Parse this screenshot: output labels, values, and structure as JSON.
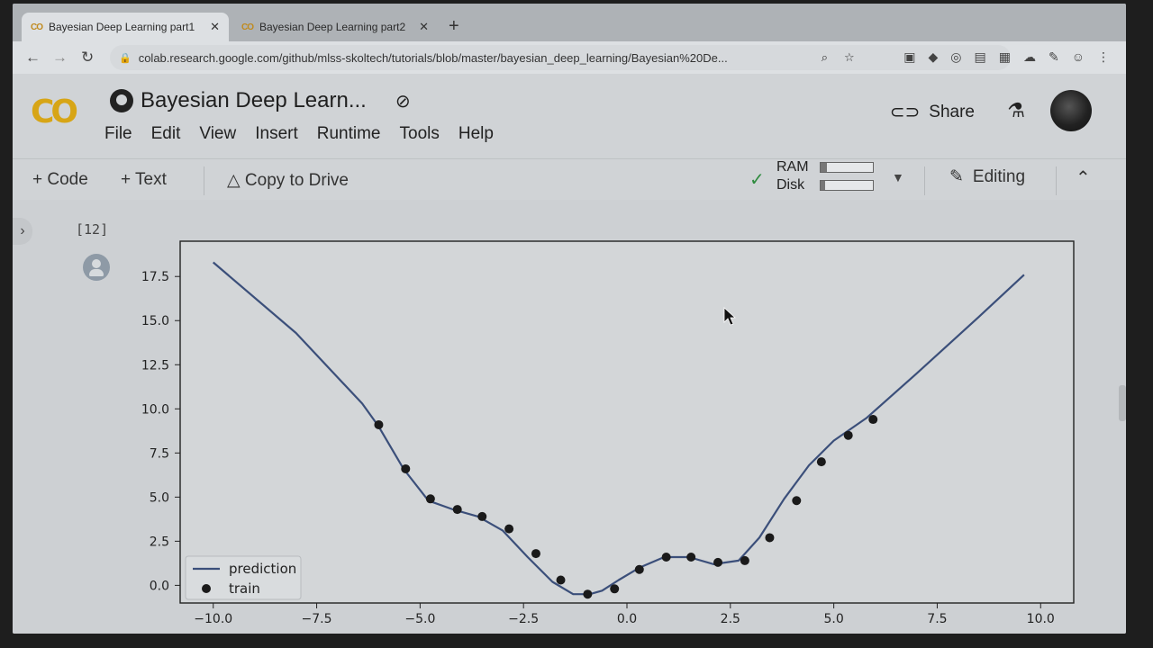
{
  "browser": {
    "tabs": [
      {
        "label": "Bayesian Deep Learning part1",
        "active": true
      },
      {
        "label": "Bayesian Deep Learning part2",
        "active": false
      }
    ],
    "new_tab": "+",
    "url": "colab.research.google.com/github/mlss-skoltech/tutorials/blob/master/bayesian_deep_learning/Bayesian%20De..."
  },
  "colab": {
    "logo": "CO",
    "notebook_title": "Bayesian Deep Learn...",
    "menu": [
      "File",
      "Edit",
      "View",
      "Insert",
      "Runtime",
      "Tools",
      "Help"
    ],
    "share_label": "Share",
    "toolbar": {
      "code_label": "+ Code",
      "text_label": "+ Text",
      "copy_label": "Copy to Drive",
      "ram_label": "RAM",
      "disk_label": "Disk",
      "ram_usage": 0.12,
      "disk_usage": 0.08,
      "editing_label": "Editing"
    }
  },
  "cell": {
    "execution_count": "[12]"
  },
  "chart_data": {
    "type": "line",
    "xlim": [
      -10.8,
      10.8
    ],
    "ylim": [
      -1.0,
      19.5
    ],
    "x_ticks": [
      -10.0,
      -7.5,
      -5.0,
      -2.5,
      0.0,
      2.5,
      5.0,
      7.5,
      10.0
    ],
    "x_tick_labels": [
      "−10.0",
      "−7.5",
      "−5.0",
      "−2.5",
      "0.0",
      "2.5",
      "5.0",
      "7.5",
      "10.0"
    ],
    "y_ticks": [
      0.0,
      2.5,
      5.0,
      7.5,
      10.0,
      12.5,
      15.0,
      17.5
    ],
    "y_tick_labels": [
      "0.0",
      "2.5",
      "5.0",
      "7.5",
      "10.0",
      "12.5",
      "15.0",
      "17.5"
    ],
    "legend": {
      "position": "lower-left",
      "entries": [
        "prediction",
        "train"
      ]
    },
    "series": [
      {
        "name": "prediction",
        "kind": "line",
        "color": "#3b4f7a",
        "x": [
          -10.0,
          -8.0,
          -6.4,
          -6.0,
          -5.4,
          -4.8,
          -4.2,
          -3.6,
          -3.0,
          -2.4,
          -1.8,
          -1.3,
          -0.9,
          -0.6,
          -0.2,
          0.3,
          0.9,
          1.5,
          2.1,
          2.7,
          3.2,
          3.8,
          4.4,
          5.0,
          5.8,
          7.0,
          8.5,
          9.6
        ],
        "y": [
          18.3,
          14.3,
          10.3,
          9.0,
          6.6,
          4.8,
          4.3,
          3.9,
          3.1,
          1.6,
          0.2,
          -0.5,
          -0.5,
          -0.3,
          0.3,
          1.0,
          1.6,
          1.6,
          1.2,
          1.4,
          2.7,
          4.9,
          6.8,
          8.2,
          9.5,
          12.0,
          15.2,
          17.6
        ]
      },
      {
        "name": "train",
        "kind": "scatter",
        "color": "#1a1a1a",
        "x": [
          -6.0,
          -5.35,
          -4.75,
          -4.1,
          -3.5,
          -2.85,
          -2.2,
          -1.6,
          -0.95,
          -0.3,
          0.3,
          0.95,
          1.55,
          2.2,
          2.85,
          3.45,
          4.1,
          4.7,
          5.35,
          5.95
        ],
        "y": [
          9.1,
          6.6,
          4.9,
          4.3,
          3.9,
          3.2,
          1.8,
          0.3,
          -0.5,
          -0.2,
          0.9,
          1.6,
          1.6,
          1.3,
          1.4,
          2.7,
          4.8,
          7.0,
          8.5,
          9.4
        ]
      }
    ]
  }
}
